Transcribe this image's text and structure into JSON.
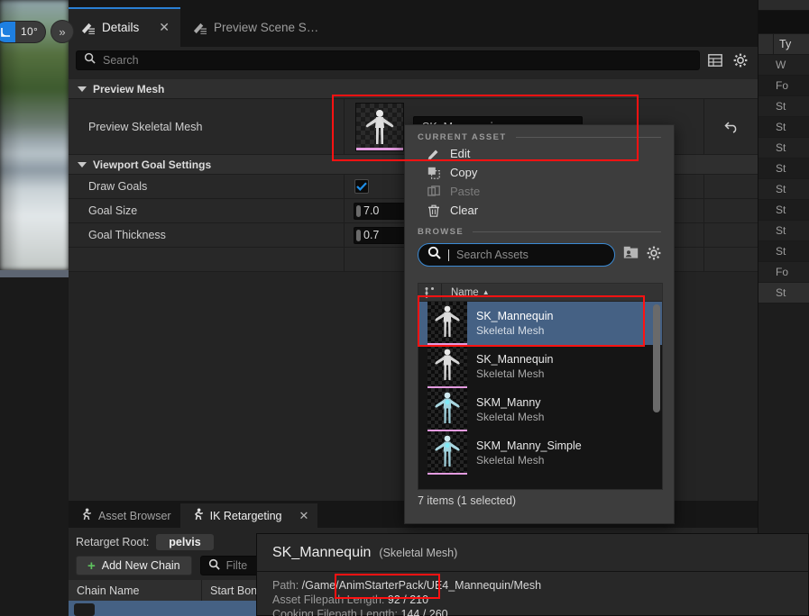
{
  "viewport": {
    "angle_snap": "10°",
    "snap_icon": "angle-snap-icon",
    "more_icon": "chevron-double-right-icon"
  },
  "details_panel": {
    "tabs": [
      {
        "label": "Details",
        "icon": "details-sheet-icon",
        "active": true,
        "closable": true
      },
      {
        "label": "Preview Scene S…",
        "icon": "details-sheet-icon",
        "active": false,
        "closable": false
      }
    ],
    "close_glyph": "✕",
    "search": {
      "placeholder": "Search",
      "icon": "search-icon"
    },
    "toolbar_icons": [
      {
        "name": "table-view-icon"
      },
      {
        "name": "gear-icon"
      }
    ],
    "categories": [
      {
        "title": "Preview Mesh",
        "rows": [
          {
            "label": "Preview Skeletal Mesh",
            "kind": "asset",
            "thumbnail": "skeletal-mesh-thumbnail",
            "value": "SK_Mannequin",
            "reset_icon": "reset-arrow-icon"
          }
        ]
      },
      {
        "title": "Viewport Goal Settings",
        "rows": [
          {
            "label": "Draw Goals",
            "kind": "checkbox",
            "checked": true
          },
          {
            "label": "Goal Size",
            "kind": "number",
            "value": "7.0"
          },
          {
            "label": "Goal Thickness",
            "kind": "number",
            "value": "0.7"
          }
        ]
      }
    ]
  },
  "asset_picker": {
    "current_asset_header": "CURRENT ASSET",
    "menu_items": [
      {
        "label": "Edit",
        "icon": "pencil-edit-icon",
        "disabled": false
      },
      {
        "label": "Copy",
        "icon": "copy-icon",
        "disabled": false
      },
      {
        "label": "Paste",
        "icon": "paste-icon",
        "disabled": true
      },
      {
        "label": "Clear",
        "icon": "trash-icon",
        "disabled": false
      }
    ],
    "browse_header": "BROWSE",
    "search": {
      "placeholder": "Search Assets",
      "icon": "search-icon"
    },
    "browse_icons": [
      {
        "name": "browse-to-asset-icon"
      },
      {
        "name": "view-options-gear-icon"
      }
    ],
    "list": {
      "column_icon": "column-options-icon",
      "column_header": "Name",
      "sort_glyph": "▲",
      "items": [
        {
          "name": "SK_Mannequin",
          "type": "Skeletal Mesh",
          "selected": true,
          "tint": "white"
        },
        {
          "name": "SK_Mannequin",
          "type": "Skeletal Mesh",
          "selected": false,
          "tint": "white"
        },
        {
          "name": "SKM_Manny",
          "type": "Skeletal Mesh",
          "selected": false,
          "tint": "cyan"
        },
        {
          "name": "SKM_Manny_Simple",
          "type": "Skeletal Mesh",
          "selected": false,
          "tint": "cyan"
        }
      ],
      "status": "7 items (1 selected)"
    }
  },
  "bottom_dock": {
    "tabs": [
      {
        "label": "Asset Browser",
        "icon": "runner-icon",
        "active": false,
        "closable": false
      },
      {
        "label": "IK Retargeting",
        "icon": "runner-icon",
        "active": true,
        "closable": true
      }
    ],
    "close_glyph": "✕",
    "retarget_root_label": "Retarget Root:",
    "retarget_root_value": "pelvis",
    "add_chain_button": "Add New Chain",
    "add_chain_plus": "+",
    "filter": {
      "placeholder": "Filte",
      "icon": "search-icon"
    },
    "table_headers": [
      "Chain Name",
      "Start Bon"
    ]
  },
  "tooltip": {
    "asset_name": "SK_Mannequin",
    "asset_type": "(Skeletal Mesh)",
    "lines": [
      {
        "key": "Path:",
        "value": "/Game/AnimStarterPack/UE4_Mannequin/Mesh"
      },
      {
        "key": "Asset Filepath Length:",
        "value": "92 / 210"
      },
      {
        "key": "Cooking Filepath Length:",
        "value": "144 / 260"
      }
    ]
  },
  "right_outliner": {
    "column_header": "Ty",
    "rows": [
      "W",
      "Fo",
      "St",
      "St",
      "St",
      "St",
      "St",
      "St",
      "St",
      "St",
      "Fo",
      "St"
    ]
  },
  "annotations": {
    "boxes": [
      {
        "name": "preview-mesh-row-highlight"
      },
      {
        "name": "asset-path-highlight"
      },
      {
        "name": "selected-asset-row-highlight"
      }
    ],
    "color": "#ff1212"
  }
}
